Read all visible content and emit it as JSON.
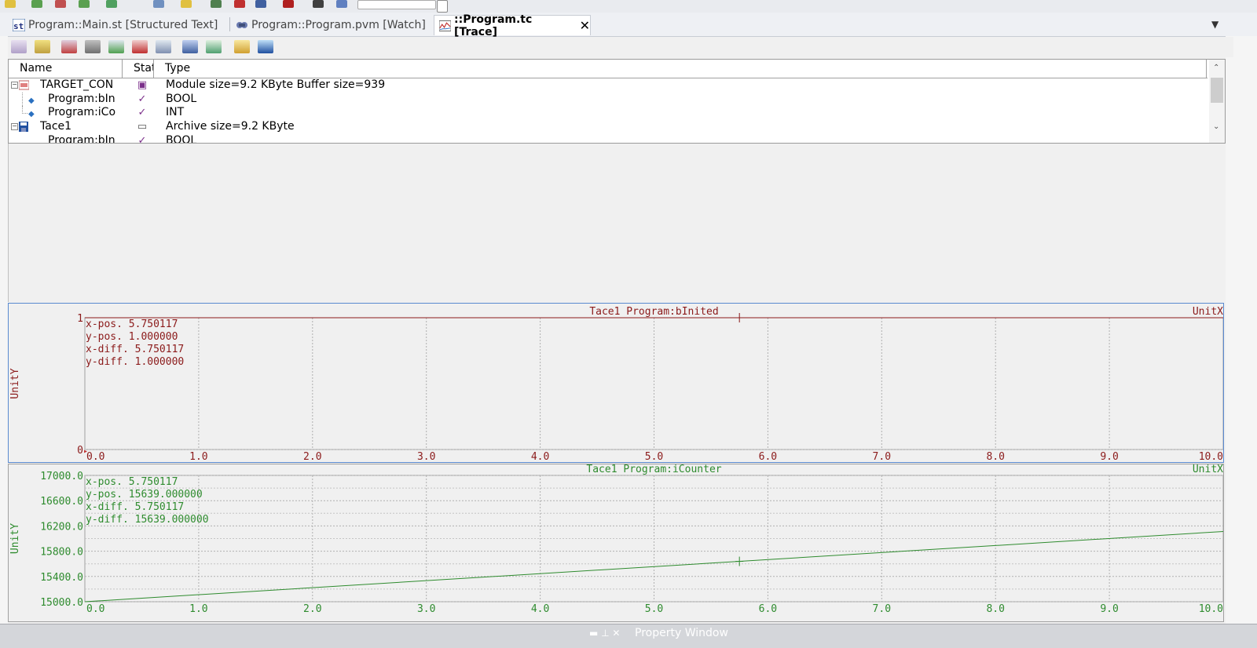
{
  "tabs": [
    {
      "label": "Program::Main.st [Structured Text]",
      "icon": "structured-text-icon",
      "active": false
    },
    {
      "label": "Program::Program.pvm [Watch]",
      "icon": "watch-icon",
      "active": false
    },
    {
      "label": "::Program.tc [Trace]",
      "icon": "trace-icon",
      "active": true
    }
  ],
  "tree": {
    "columns": [
      "Name",
      "Stat",
      "Type"
    ],
    "rows": [
      {
        "name": "TARGET_CON",
        "status_icon": "target-status-icon",
        "type": "Module size=9.2 KByte   Buffer size=939"
      },
      {
        "name": "Program:bIn",
        "status_icon": "check-icon",
        "type": "BOOL"
      },
      {
        "name": "Program:iCo",
        "status_icon": "check-icon",
        "type": "INT"
      },
      {
        "name": "Tace1",
        "status_icon": "archive-status-icon",
        "type": "Archive size=9.2 KByte"
      },
      {
        "name": "Program:bIn",
        "status_icon": "check-icon",
        "type": "BOOL"
      }
    ]
  },
  "chart_data": [
    {
      "type": "line",
      "title": "Tace1     Program:bInited",
      "xlabel": "UnitX",
      "ylabel": "UnitY",
      "xlim": [
        0,
        10
      ],
      "ylim": [
        0,
        1
      ],
      "x_ticks": [
        "0.0",
        "1.0",
        "2.0",
        "3.0",
        "4.0",
        "5.0",
        "6.0",
        "7.0",
        "8.0",
        "9.0",
        "10.0"
      ],
      "y_ticks": [
        "0",
        "1"
      ],
      "series": [
        {
          "x": [
            0,
            10
          ],
          "y": [
            1,
            1
          ],
          "color": "#8b1a1a"
        }
      ],
      "cursor": {
        "x": 5.750117,
        "y": 1.0
      },
      "readout": [
        "x-pos.  5.750117",
        "y-pos.  1.000000",
        "x-diff. 5.750117",
        "y-diff. 1.000000"
      ],
      "color": "#8b1a1a",
      "grid": true
    },
    {
      "type": "line",
      "title": "Tace1     Program:iCounter",
      "xlabel": "UnitX",
      "ylabel": "UnitY",
      "xlim": [
        0,
        10
      ],
      "ylim": [
        15000,
        17000
      ],
      "x_ticks": [
        "0.0",
        "1.0",
        "2.0",
        "3.0",
        "4.0",
        "5.0",
        "6.0",
        "7.0",
        "8.0",
        "9.0",
        "10.0"
      ],
      "y_ticks": [
        "15000.0",
        "15400.0",
        "15800.0",
        "16200.0",
        "16600.0",
        "17000.0"
      ],
      "series": [
        {
          "x": [
            0,
            10
          ],
          "y": [
            15000,
            16112
          ],
          "color": "#2e8b2e"
        }
      ],
      "cursor": {
        "x": 5.750117,
        "y": 15639
      },
      "readout": [
        "x-pos.      5.750117",
        "y-pos.  15639.000000",
        "x-diff.     5.750117",
        "y-diff. 15639.000000"
      ],
      "color": "#2e8b2e",
      "grid": true
    }
  ],
  "bottom": {
    "panel_title": "Property Window"
  }
}
